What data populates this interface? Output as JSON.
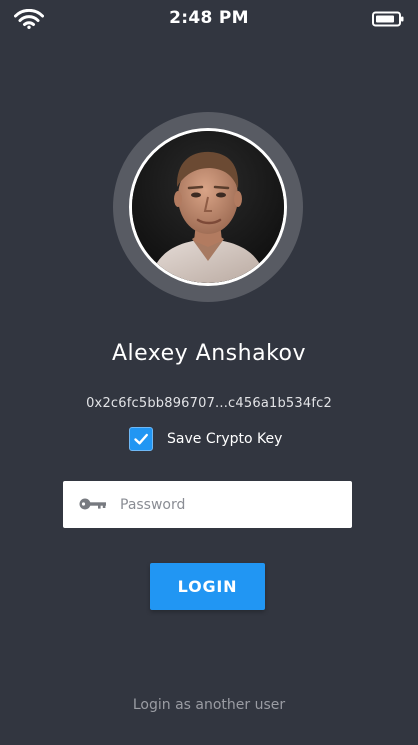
{
  "status_bar": {
    "time": "2:48 PM",
    "wifi_icon": "wifi-icon",
    "battery_icon": "battery-icon"
  },
  "profile": {
    "name": "Alexey Anshakov",
    "crypto_key": "0x2c6fc5bb896707...c456a1b534fc2",
    "avatar_icon": "user-photo"
  },
  "save_key": {
    "label": "Save Crypto Key",
    "checked": true
  },
  "password": {
    "placeholder": "Password",
    "value": "",
    "icon": "key-icon"
  },
  "login_button": {
    "label": "LOGIN"
  },
  "another_user": {
    "label": "Login as another user"
  },
  "colors": {
    "background": "#323640",
    "accent": "#2196f3",
    "avatar_ring": "#585b63",
    "muted_text": "#9a9ca3"
  }
}
